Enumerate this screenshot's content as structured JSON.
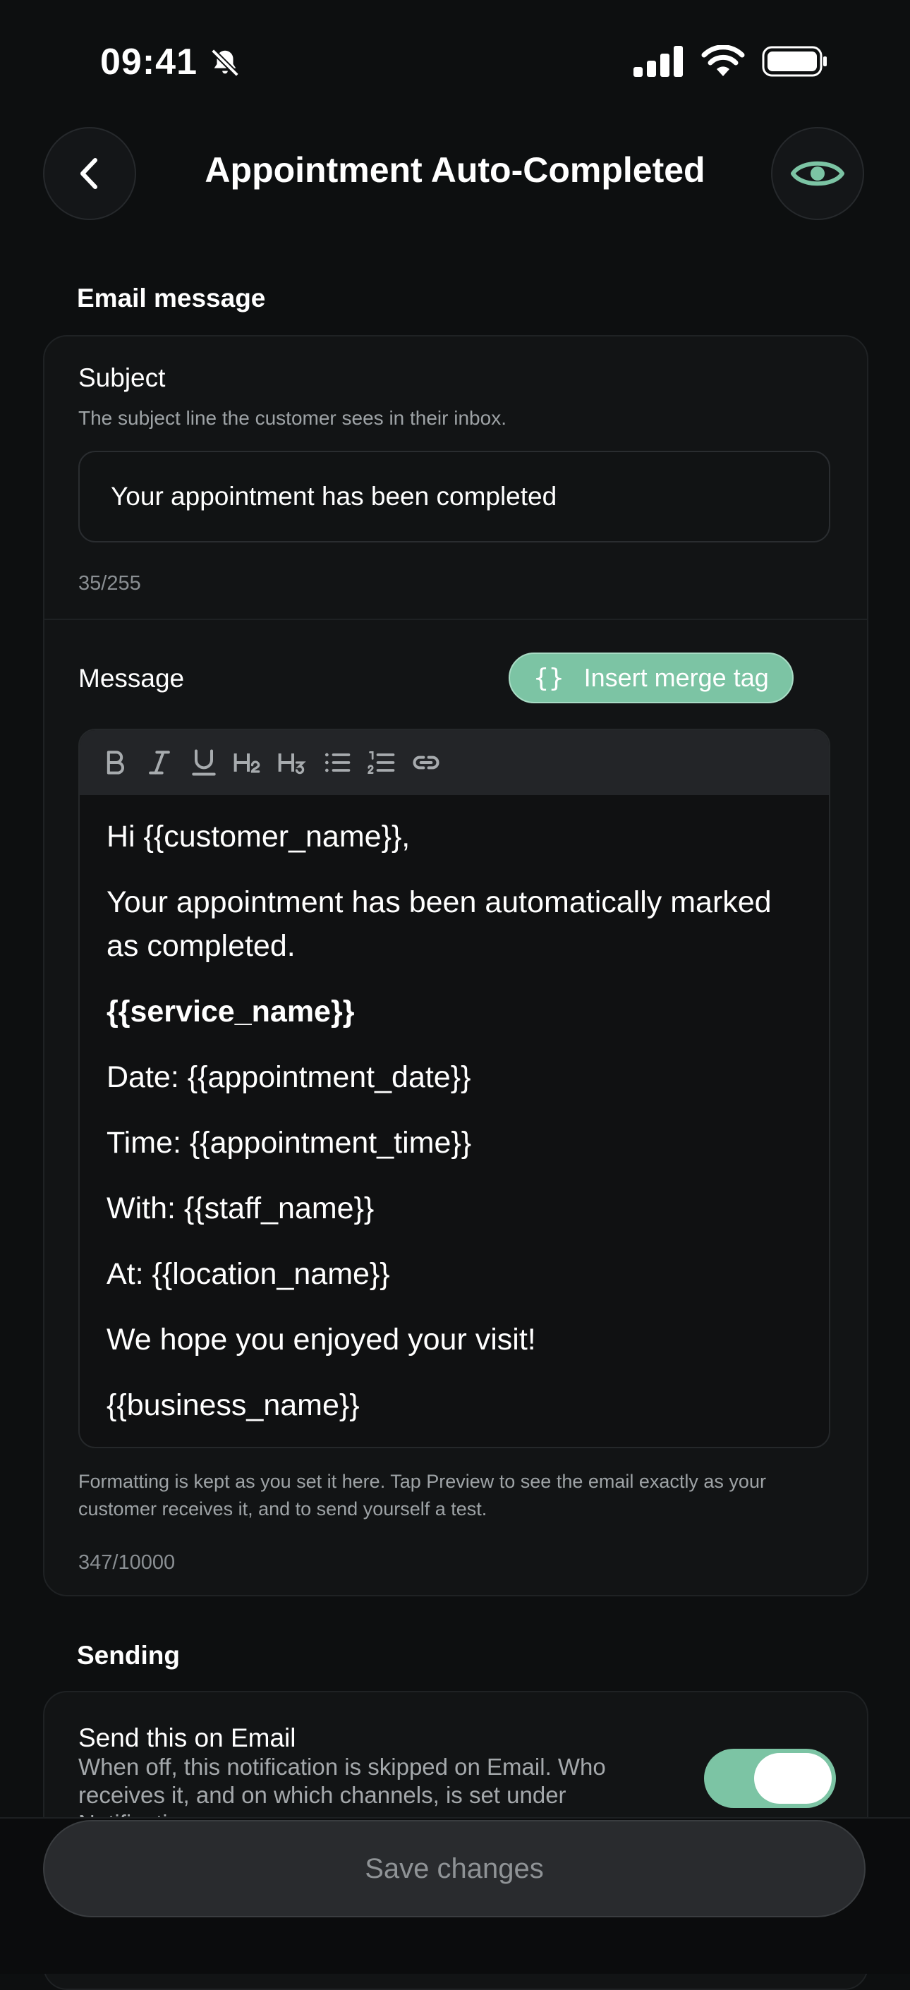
{
  "status_bar": {
    "time": "09:41"
  },
  "header": {
    "title": "Appointment Auto-Completed"
  },
  "email_section": {
    "label": "Email message",
    "subject": {
      "label": "Subject",
      "help": "The subject line the customer sees in their inbox.",
      "value": "Your appointment has been completed",
      "counter": "35/255"
    },
    "message": {
      "label": "Message",
      "merge_tag_button": "Insert merge tag",
      "merge_tag_icon": "{}",
      "toolbar": [
        "bold-icon",
        "italic-icon",
        "underline-icon",
        "heading2-icon",
        "heading3-icon",
        "bullet-list-icon",
        "numbered-list-icon",
        "link-icon"
      ],
      "lines": [
        "Hi {{customer_name}},",
        "Your appointment has been automatically marked as completed.",
        "{{service_name}}",
        "Date: {{appointment_date}}",
        "Time: {{appointment_time}}",
        "With: {{staff_name}}",
        "At: {{location_name}}",
        "We hope you enjoyed your visit!",
        "{{business_name}}"
      ],
      "help": "Formatting is kept as you set it here. Tap Preview to see the email exactly as your customer receives it, and to send yourself a test.",
      "counter": "347/10000"
    }
  },
  "sending_section": {
    "label": "Sending",
    "send_email": {
      "label": "Send this on Email",
      "help": "When off, this notification is skipped on Email. Who receives it, and on which channels, is set under Notifications.",
      "enabled": true
    }
  },
  "footer": {
    "save_label": "Save changes"
  },
  "colors": {
    "accent": "#7cc4a4",
    "background": "#0d0f10",
    "card": "#121415"
  }
}
